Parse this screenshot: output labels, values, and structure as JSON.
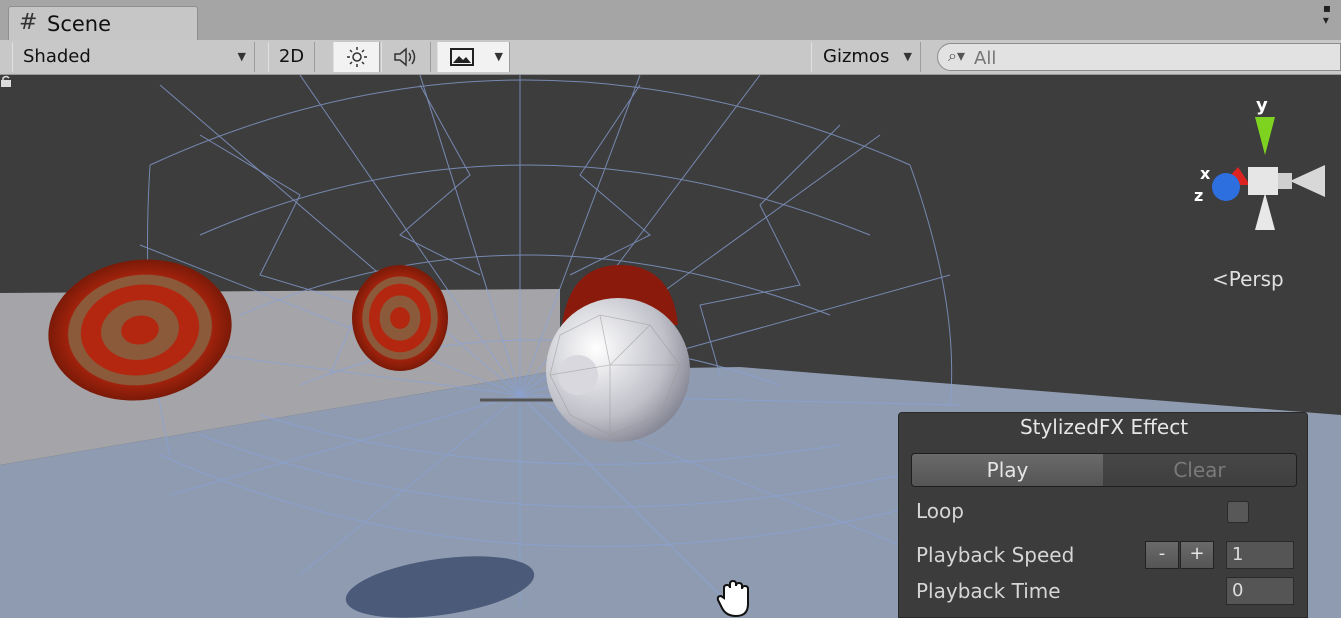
{
  "tab": {
    "title": "Scene"
  },
  "toolbar": {
    "shading_mode": "Shaded",
    "mode_2d": "2D",
    "gizmos_label": "Gizmos",
    "search_placeholder": "All"
  },
  "orientation_gizmo": {
    "axis_y": "y",
    "axis_x": "x",
    "axis_z": "z",
    "projection": "Persp"
  },
  "effect_panel": {
    "title": "StylizedFX Effect",
    "play_label": "Play",
    "clear_label": "Clear",
    "loop_label": "Loop",
    "loop_checked": false,
    "speed_label": "Playback Speed",
    "speed_minus": "-",
    "speed_plus": "+",
    "speed_value": "1",
    "time_label": "Playback Time",
    "time_value": "0"
  },
  "icons": [
    "grid-hash-icon",
    "dropdown-arrow-icon",
    "sun-lighting-icon",
    "audio-speaker-icon",
    "image-effects-icon",
    "search-icon",
    "lock-icon",
    "hand-cursor-icon"
  ],
  "colors": {
    "viewport_bg": "#3d3d3d",
    "ground": "#8e9bb0",
    "wireframe": "#8aa2d8",
    "target_red": "#b3260f",
    "gizmo_y": "#7ed321",
    "gizmo_z": "#2e6fe0",
    "gizmo_x": "#d22"
  }
}
